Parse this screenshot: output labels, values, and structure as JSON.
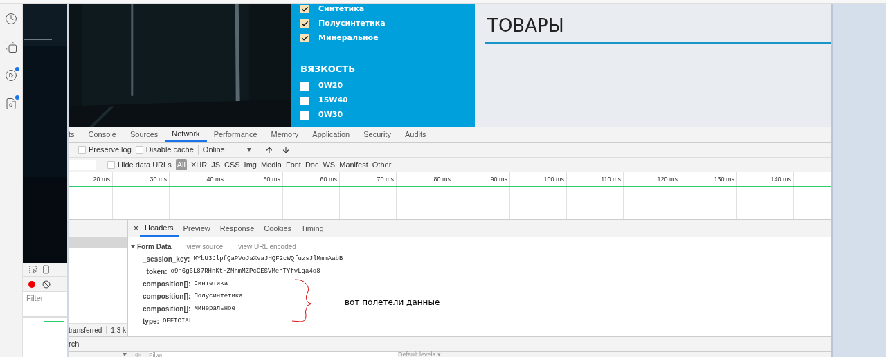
{
  "sidebar": {
    "icons": [
      {
        "kind": "clock",
        "badge": false
      },
      {
        "kind": "documents",
        "badge": false
      },
      {
        "kind": "play",
        "badge": true
      },
      {
        "kind": "search",
        "badge": true
      }
    ]
  },
  "filter_panel": {
    "composition": [
      {
        "label": "Синтетика",
        "checked": true
      },
      {
        "label": "Полусинтетика",
        "checked": true
      },
      {
        "label": "Минеральное",
        "checked": true
      }
    ],
    "viscosity_title": "ВЯЗКОСТЬ",
    "viscosity": [
      {
        "label": "0W20",
        "checked": false
      },
      {
        "label": "15W40",
        "checked": false
      },
      {
        "label": "0W30",
        "checked": false
      }
    ]
  },
  "page": {
    "title": "ТОВАРЫ"
  },
  "devtools": {
    "tabs": [
      {
        "label": "ts",
        "selected": false
      },
      {
        "label": "Console",
        "selected": false
      },
      {
        "label": "Sources",
        "selected": false
      },
      {
        "label": "Network",
        "selected": true
      },
      {
        "label": "Performance",
        "selected": false
      },
      {
        "label": "Memory",
        "selected": false
      },
      {
        "label": "Application",
        "selected": false
      },
      {
        "label": "Security",
        "selected": false
      },
      {
        "label": "Audits",
        "selected": false
      }
    ],
    "toolbar": {
      "preserve_log": {
        "label": "Preserve log",
        "checked": false
      },
      "disable_cache": {
        "label": "Disable cache",
        "checked": false
      },
      "throttling": "Online"
    },
    "filter_bar": {
      "hide_data_urls": {
        "label": "Hide data URLs",
        "checked": false
      },
      "types": [
        {
          "label": "All",
          "selected": true
        },
        {
          "label": "XHR",
          "selected": false
        },
        {
          "label": "JS",
          "selected": false
        },
        {
          "label": "CSS",
          "selected": false
        },
        {
          "label": "Img",
          "selected": false
        },
        {
          "label": "Media",
          "selected": false
        },
        {
          "label": "Font",
          "selected": false
        },
        {
          "label": "Doc",
          "selected": false
        },
        {
          "label": "WS",
          "selected": false
        },
        {
          "label": "Manifest",
          "selected": false
        },
        {
          "label": "Other",
          "selected": false
        }
      ]
    },
    "timeline": {
      "ticks": [
        "20 ms",
        "30 ms",
        "40 ms",
        "50 ms",
        "60 ms",
        "70 ms",
        "80 ms",
        "90 ms",
        "100 ms",
        "110 ms",
        "120 ms",
        "130 ms",
        "140 ms"
      ]
    },
    "detail_close": "×",
    "detail_tabs": [
      {
        "label": "Headers",
        "selected": true
      },
      {
        "label": "Preview",
        "selected": false
      },
      {
        "label": "Response",
        "selected": false
      },
      {
        "label": "Cookies",
        "selected": false
      },
      {
        "label": "Timing",
        "selected": false
      }
    ],
    "form_data": {
      "title": "Form Data",
      "expanded": true,
      "links": [
        "view source",
        "view URL encoded"
      ],
      "rows": [
        {
          "key": "_session_key:",
          "value": "MYbU3JlpfQaPVoJaXvaJHQF2cWQfuzsJlMmmAabB"
        },
        {
          "key": "_token:",
          "value": "o9n6g6L87RHnKtHZMhmMZPcGESVMehTYfvLqa4o8"
        },
        {
          "key": "composition[]:",
          "value": "Синтетика"
        },
        {
          "key": "composition[]:",
          "value": "Полусинтетика"
        },
        {
          "key": "composition[]:",
          "value": "Минеральное"
        },
        {
          "key": "type:",
          "value": "OFFICIAL"
        }
      ]
    },
    "status": [
      "transferred",
      "1.3 k"
    ],
    "console_tab": "rch",
    "console_filter_placeholder": "Filter",
    "levels": "Default levels ▾"
  },
  "side_devtools": {
    "filter_placeholder": "Filter"
  },
  "annotation": "вот полетели данные"
}
